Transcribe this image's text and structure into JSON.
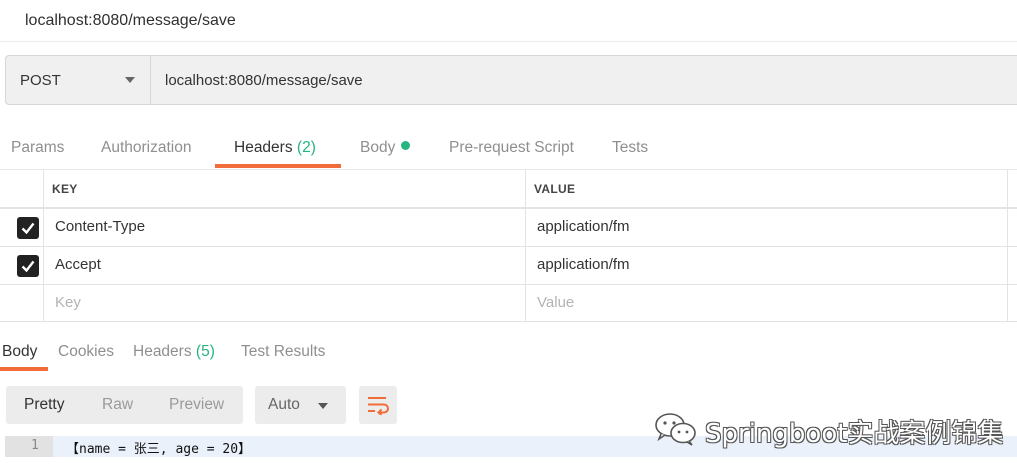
{
  "title": "localhost:8080/message/save",
  "request": {
    "method": "POST",
    "url": "localhost:8080/message/save"
  },
  "request_tabs": {
    "params": "Params",
    "authorization": "Authorization",
    "headers": "Headers",
    "headers_count": "(2)",
    "body": "Body",
    "prerequest": "Pre-request Script",
    "tests": "Tests"
  },
  "headers_table": {
    "col_key": "KEY",
    "col_value": "VALUE",
    "rows": [
      {
        "checked": true,
        "key": "Content-Type",
        "value": "application/fm"
      },
      {
        "checked": true,
        "key": "Accept",
        "value": "application/fm"
      }
    ],
    "placeholder_key": "Key",
    "placeholder_value": "Value"
  },
  "response_tabs": {
    "body": "Body",
    "cookies": "Cookies",
    "headers": "Headers",
    "headers_count": "(5)",
    "test_results": "Test Results"
  },
  "response_toolbar": {
    "pretty": "Pretty",
    "raw": "Raw",
    "preview": "Preview",
    "format": "Auto"
  },
  "response_body": {
    "line_number": "1",
    "text": "【name = 张三, age = 20】"
  },
  "watermark": "Springboot实战案例锦集",
  "colors": {
    "accent": "#f26b3a",
    "green": "#26b47f"
  }
}
